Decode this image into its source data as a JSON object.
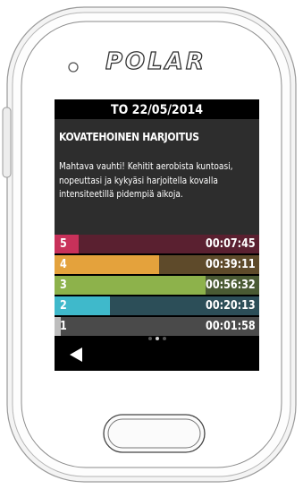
{
  "device": {
    "brand": "POLAR"
  },
  "screen": {
    "date": "TO 22/05/2014",
    "title": "KOVATEHOINEN HARJOITUS",
    "description": "Mahtava vauhti! Kehitit aerobista kuntoasi, nopeuttasi ja kykyäsi harjoitella kovalla intensiteetillä pidempiä aikoja.",
    "zones": [
      {
        "zone": "5",
        "time": "00:07:45",
        "fraction": 0.12,
        "color": "#c8315a",
        "track": "#5a2030"
      },
      {
        "zone": "4",
        "time": "00:39:11",
        "fraction": 0.51,
        "color": "#e4a23c",
        "track": "#5e4a2a"
      },
      {
        "zone": "3",
        "time": "00:56:32",
        "fraction": 0.74,
        "color": "#8db24b",
        "track": "#4a5a33"
      },
      {
        "zone": "2",
        "time": "00:20:13",
        "fraction": 0.27,
        "color": "#3fb9cb",
        "track": "#2c4e58"
      },
      {
        "zone": "1",
        "time": "00:01:58",
        "fraction": 0.03,
        "color": "#bdbdbd",
        "track": "#4a4a4a"
      }
    ],
    "pager": {
      "count": 3,
      "active": 1
    },
    "back_icon": "back-arrow-icon"
  }
}
